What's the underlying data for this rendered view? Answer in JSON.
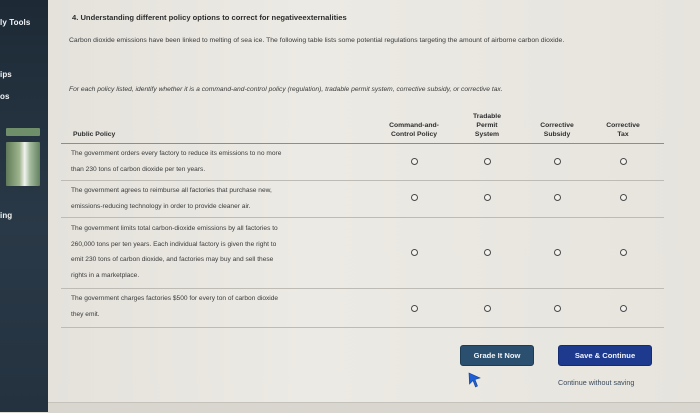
{
  "sidebar": {
    "labels": [
      "ly Tools",
      "ips",
      "os",
      "ing"
    ],
    "colors": {
      "bg": "#1d2a36"
    }
  },
  "question": {
    "title": "4. Understanding different policy options to correct for negativeexternalities",
    "intro": "Carbon dioxide emissions have been linked to melting of sea ice. The following table lists some potential regulations targeting the amount of airborne carbon dioxide.",
    "instruction": "For each policy listed, identify whether it is a command-and-control policy (regulation), tradable permit system, corrective subsidy, or corrective tax."
  },
  "table": {
    "headers": {
      "policy": "Public Policy",
      "col1": [
        "Command-and-",
        "Control Policy"
      ],
      "col2": [
        "Tradable",
        "Permit",
        "System"
      ],
      "col3": [
        "Corrective",
        "Subsidy"
      ],
      "col4": [
        "Corrective",
        "Tax"
      ]
    },
    "rows": [
      {
        "lines": [
          "The government orders every factory to reduce its emissions to no more",
          "than 230 tons of carbon dioxide per ten years."
        ]
      },
      {
        "lines": [
          "The government agrees to reimburse all factories that purchase new,",
          "emissions-reducing technology in order to provide cleaner air."
        ]
      },
      {
        "lines": [
          "The government limits total carbon-dioxide emissions by all factories to",
          "260,000 tons per ten years. Each individual factory is given the right to",
          "emit 230 tons of carbon dioxide, and factories may buy and sell these",
          "rights in a marketplace."
        ]
      },
      {
        "lines": [
          "The government charges factories $500 for every ton of carbon dioxide",
          "they emit."
        ]
      }
    ]
  },
  "buttons": {
    "grade": "Grade It Now",
    "save": "Save & Continue",
    "continue_link": "Continue without saving"
  },
  "colors": {
    "grade_button": "#2b4f6e",
    "save_button": "#1d3a8e",
    "cursor": "#1f5fd6"
  }
}
